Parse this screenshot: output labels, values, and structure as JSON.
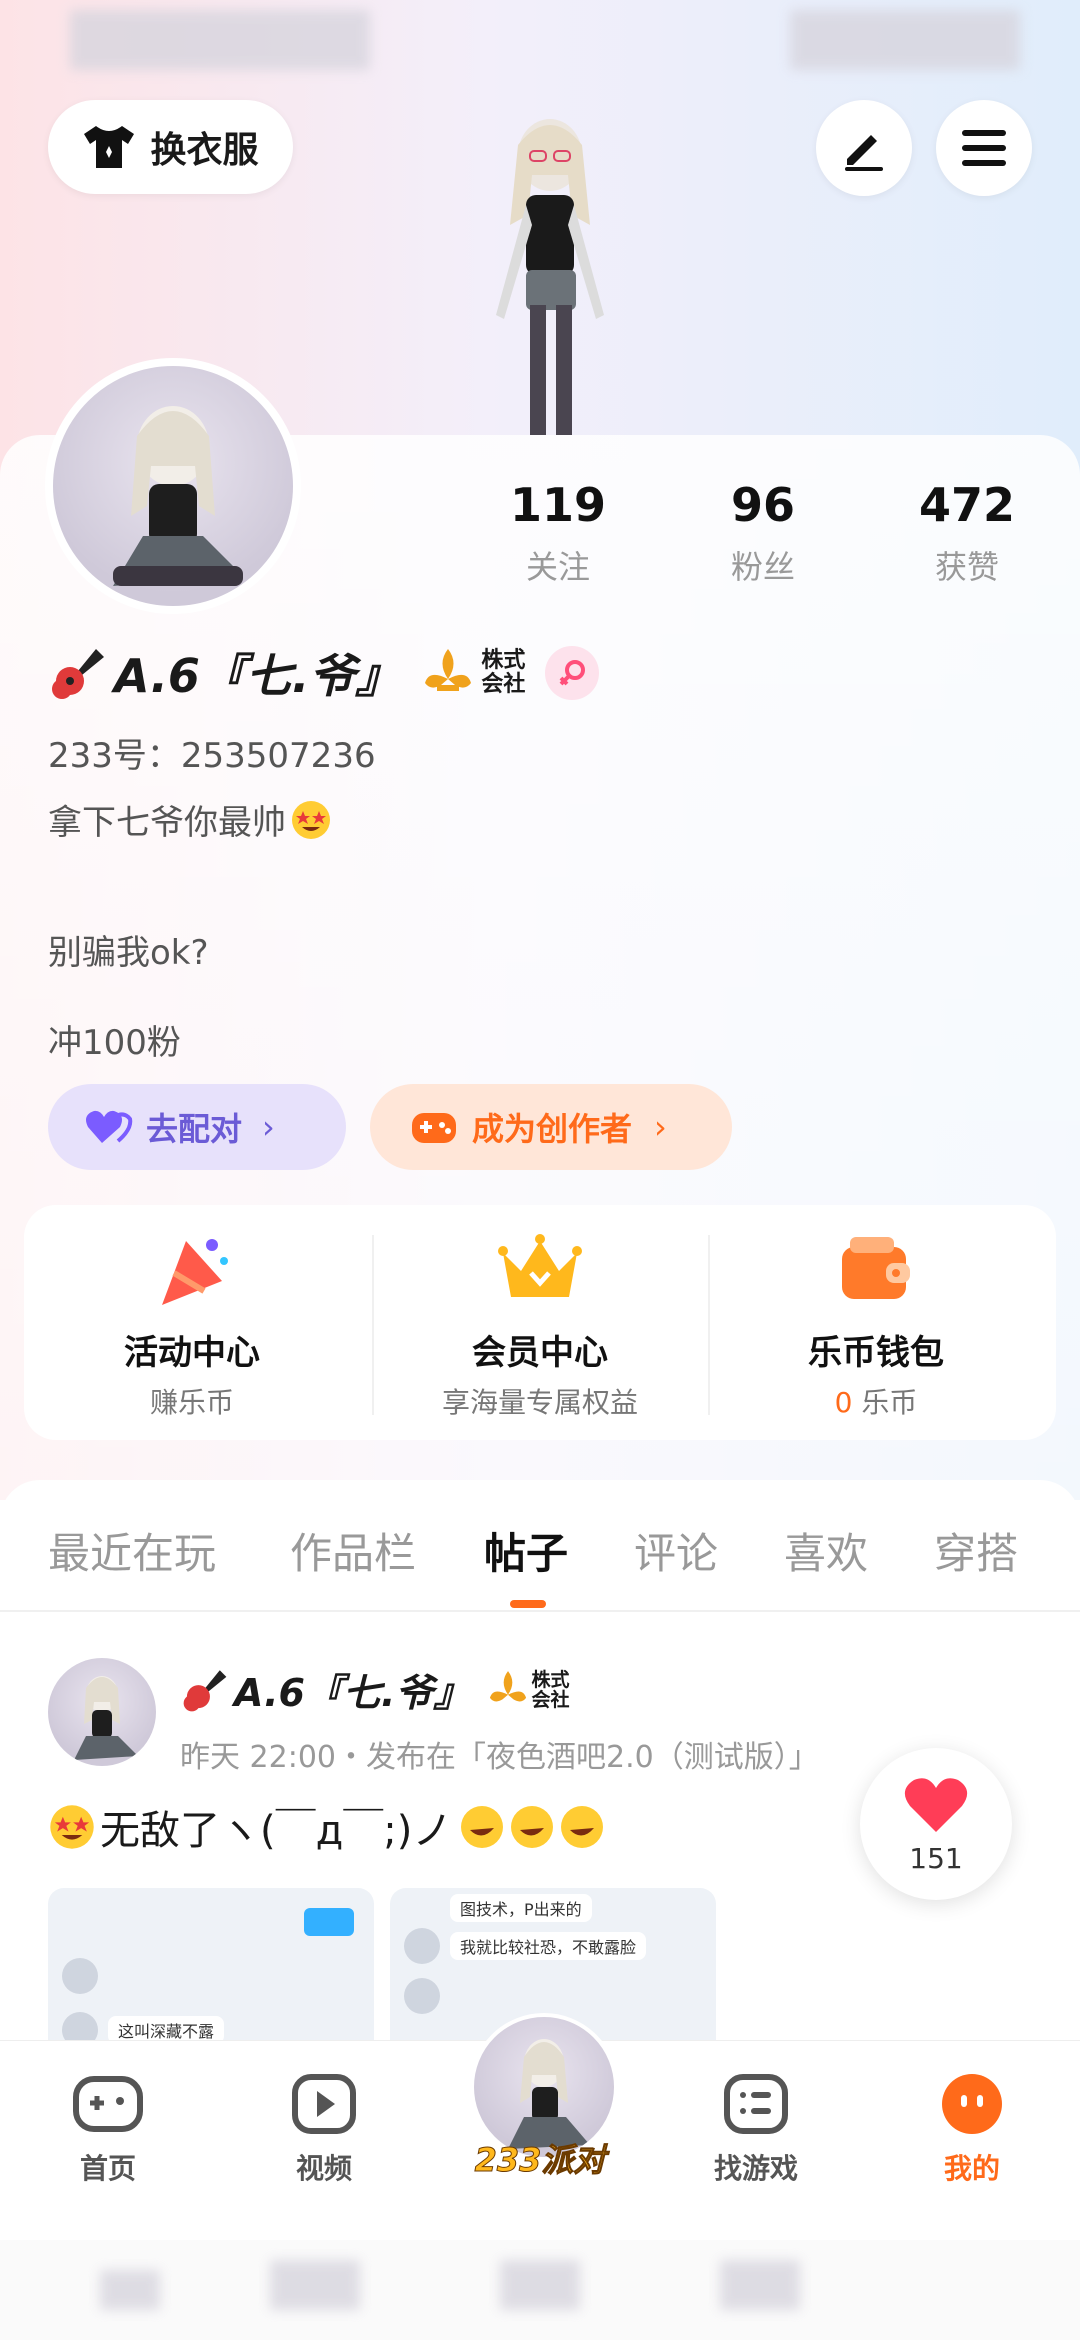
{
  "top": {
    "change_clothes": "换衣服"
  },
  "stats": [
    {
      "num": "119",
      "label": "关注"
    },
    {
      "num": "96",
      "label": "粉丝"
    },
    {
      "num": "472",
      "label": "获赞"
    }
  ],
  "profile": {
    "name": "A.6『七.爷』",
    "badge_text": "株式会社",
    "id_line": "233号：253507236",
    "bio1": "拿下七爷你最帅",
    "bio2": "别骗我ok?",
    "bio3": "冲100粉"
  },
  "actions": {
    "match": "去配对",
    "creator": "成为创作者"
  },
  "services": [
    {
      "title": "活动中心",
      "sub": "赚乐币"
    },
    {
      "title": "会员中心",
      "sub": "享海量专属权益"
    },
    {
      "title": "乐币钱包",
      "sub_num": "0",
      "sub": "乐币"
    }
  ],
  "tabs": [
    "最近在玩",
    "作品栏",
    "帖子",
    "评论",
    "喜欢",
    "穿搭"
  ],
  "post": {
    "author": "A.6『七.爷』",
    "badge_text": "株式会社",
    "meta": "昨天 22:00・发布在「夜色酒吧2.0（测试版）」",
    "content": "无敌了ヽ(￣д￣;)ノ",
    "likes": "151",
    "thumb1_line1": "这叫深藏不露",
    "thumb2_line1": "图技术，P出来的",
    "thumb2_line2": "我就比较社恐，不敢露脸"
  },
  "nav": {
    "home": "首页",
    "video": "视频",
    "party": "233派对",
    "find": "找游戏",
    "mine": "我的"
  },
  "colors": {
    "accent_orange": "#ff6a1a",
    "purple": "#7b5cff",
    "pink": "#ff4f7a"
  }
}
